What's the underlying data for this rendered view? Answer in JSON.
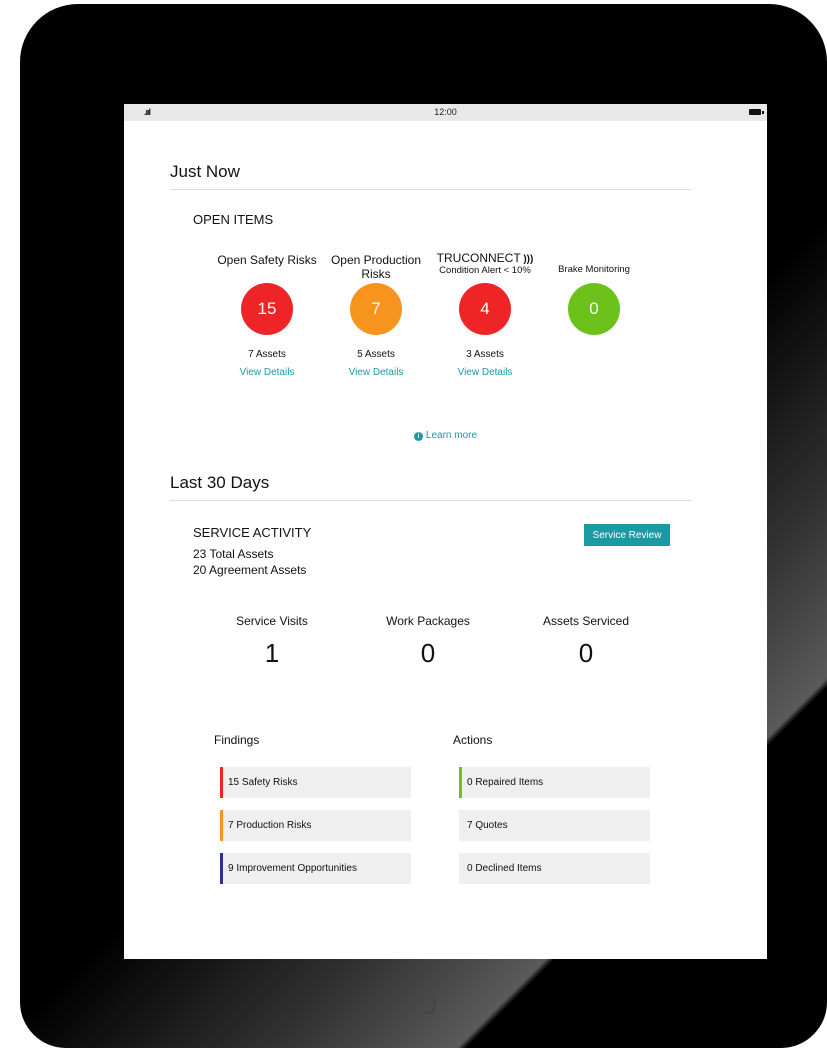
{
  "status_bar": {
    "time": "12:00",
    "signal": ".ııl"
  },
  "just_now": {
    "title": "Just Now",
    "open_items_title": "OPEN ITEMS",
    "metrics": [
      {
        "label": "Open Safety Risks",
        "value": "15",
        "assets": "7 Assets",
        "link": "View Details",
        "color": "#ee2427"
      },
      {
        "label": "Open Production Risks",
        "value": "7",
        "assets": "5 Assets",
        "link": "View Details",
        "color": "#f7941d"
      },
      {
        "label": "TRUCONNECT",
        "sublabel": "Condition Alert < 10%",
        "icon": "rss-icon",
        "value": "4",
        "assets": "3 Assets",
        "link": "View Details",
        "color": "#ee2427"
      },
      {
        "label": "Brake Monitoring",
        "value": "0",
        "color": "#6cc21b"
      }
    ],
    "learn_more": "Learn more"
  },
  "last_30_days": {
    "title": "Last 30 Days",
    "service_title": "SERVICE ACTIVITY",
    "total_assets": "23 Total Assets",
    "agreement_assets": "20 Agreement Assets",
    "review_button": "Service Review",
    "stats": [
      {
        "label": "Service Visits",
        "value": "1"
      },
      {
        "label": "Work Packages",
        "value": "0"
      },
      {
        "label": "Assets Serviced",
        "value": "0"
      }
    ],
    "findings_title": "Findings",
    "findings": [
      {
        "label": "15 Safety Risks",
        "color": "#ee2427"
      },
      {
        "label": "7 Production Risks",
        "color": "#f7941d"
      },
      {
        "label": "9 Improvement Opportunities",
        "color": "#2e3192"
      }
    ],
    "actions_title": "Actions",
    "actions": [
      {
        "label": "0 Repaired Items",
        "color": "#6cc21b"
      },
      {
        "label": "7 Quotes",
        "color": ""
      },
      {
        "label": "0 Declined Items",
        "color": ""
      }
    ]
  }
}
